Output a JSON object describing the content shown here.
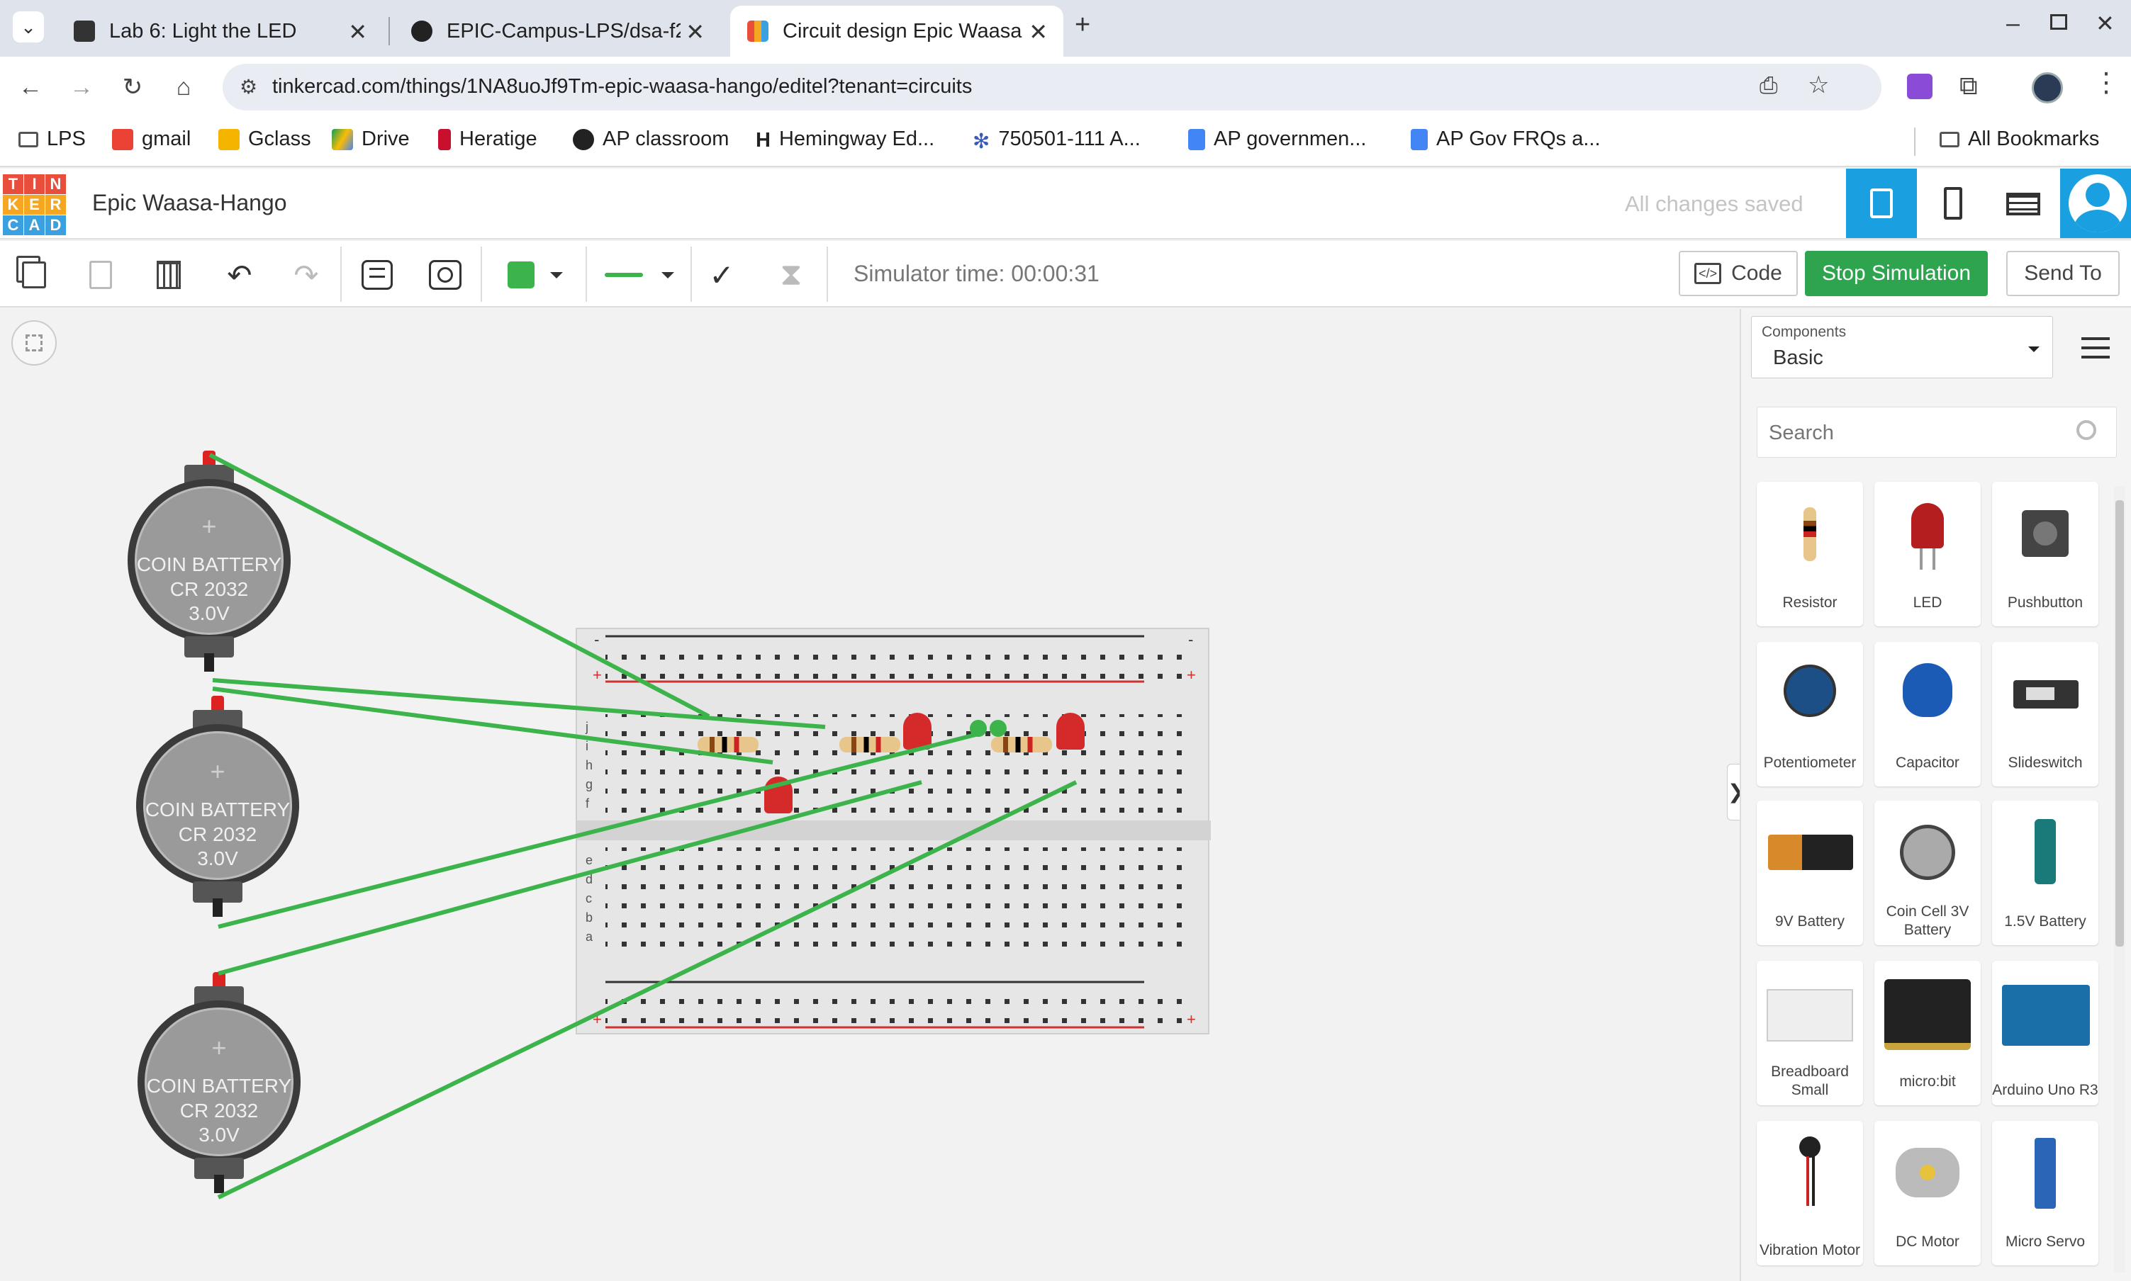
{
  "browser": {
    "tabs": [
      {
        "title": "Lab 6: Light the LED"
      },
      {
        "title": "EPIC-Campus-LPS/dsa-f2"
      },
      {
        "title": "Circuit design Epic Waasa"
      }
    ],
    "new_tab": "+",
    "url": "tinkercad.com/things/1NA8uoJf9Tm-epic-waasa-hango/editel?tenant=circuits",
    "bookmarks": [
      "LPS",
      "gmail",
      "Gclass",
      "Drive",
      "Heratige",
      "AP classroom",
      "Hemingway Ed...",
      "750501-111 A...",
      "AP governmen...",
      "AP Gov FRQs a..."
    ],
    "all_bookmarks": "All Bookmarks"
  },
  "app": {
    "logo": [
      "T",
      "I",
      "N",
      "K",
      "E",
      "R",
      "C",
      "A",
      "D"
    ],
    "design_name": "Epic Waasa-Hango",
    "save_status": "All changes saved",
    "colors": {
      "accent": "#1aa0e0",
      "sim_button": "#2ea44f",
      "wire": "#3cb44b"
    }
  },
  "toolbar": {
    "simulator_time": "Simulator time: 00:00:31",
    "code_label": "Code",
    "stop_label": "Stop Simulation",
    "send_label": "Send To"
  },
  "canvas": {
    "batteries": [
      {
        "line1": "COIN BATTERY",
        "line2": "CR 2032",
        "line3": "3.0V"
      },
      {
        "line1": "COIN BATTERY",
        "line2": "CR 2032",
        "line3": "3.0V"
      },
      {
        "line1": "COIN BATTERY",
        "line2": "CR 2032",
        "line3": "3.0V"
      }
    ],
    "breadboard": {
      "rows_top": [
        "j",
        "i",
        "h",
        "g",
        "f"
      ],
      "rows_bottom": [
        "e",
        "d",
        "c",
        "b",
        "a"
      ]
    },
    "collapse_arrow": "❯"
  },
  "panel": {
    "dropdown_label": "Components",
    "dropdown_value": "Basic",
    "search_placeholder": "Search",
    "components": [
      {
        "label": "Resistor",
        "icon": "resistor-icon"
      },
      {
        "label": "LED",
        "icon": "led-icon"
      },
      {
        "label": "Pushbutton",
        "icon": "pushbutton-icon"
      },
      {
        "label": "Potentiometer",
        "icon": "potentiometer-icon"
      },
      {
        "label": "Capacitor",
        "icon": "capacitor-icon"
      },
      {
        "label": "Slideswitch",
        "icon": "slideswitch-icon"
      },
      {
        "label": "9V Battery",
        "icon": "9v-battery-icon"
      },
      {
        "label": "Coin Cell 3V Battery",
        "icon": "coin-cell-icon"
      },
      {
        "label": "1.5V Battery",
        "icon": "aa-battery-icon"
      },
      {
        "label": "Breadboard Small",
        "icon": "breadboard-icon"
      },
      {
        "label": "micro:bit",
        "icon": "microbit-icon"
      },
      {
        "label": "Arduino Uno R3",
        "icon": "arduino-icon"
      },
      {
        "label": "Vibration Motor",
        "icon": "vibration-motor-icon"
      },
      {
        "label": "DC Motor",
        "icon": "dc-motor-icon"
      },
      {
        "label": "Micro Servo",
        "icon": "micro-servo-icon"
      }
    ]
  }
}
